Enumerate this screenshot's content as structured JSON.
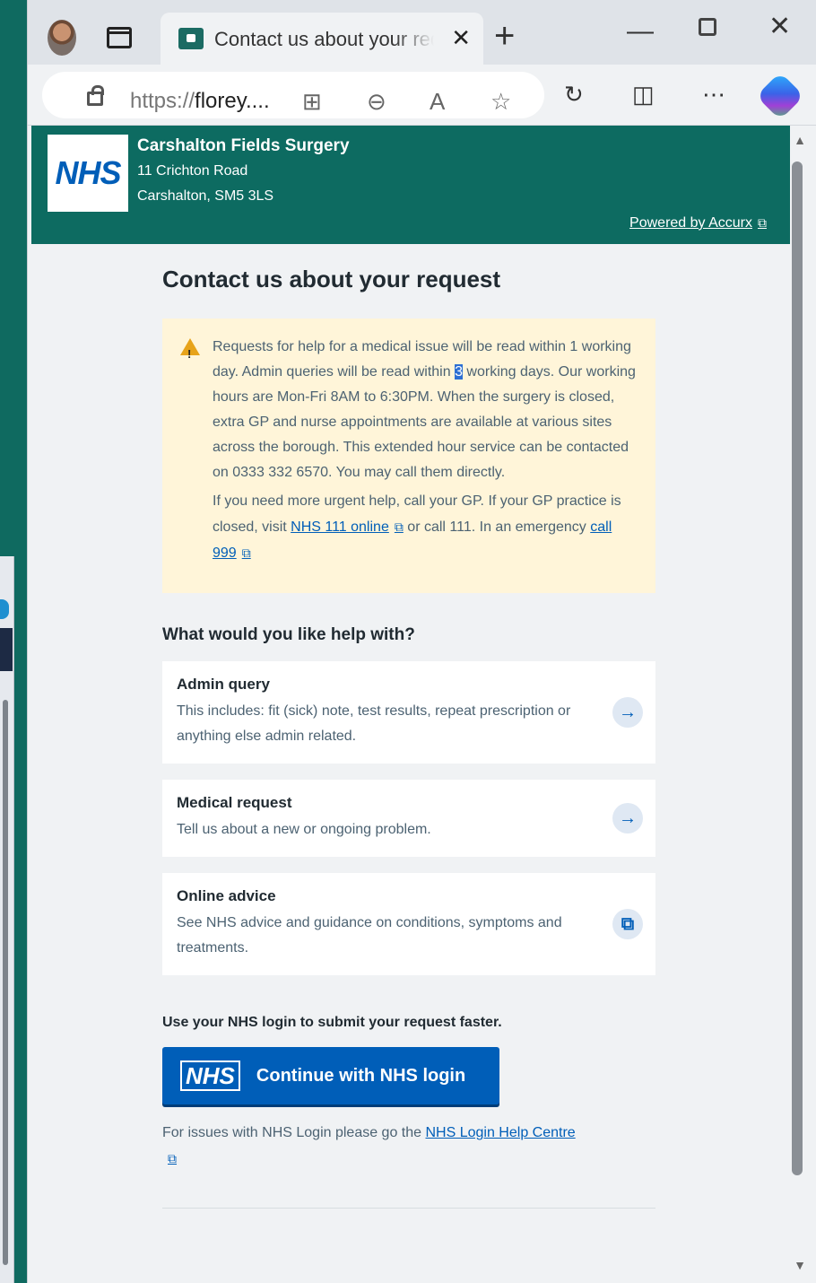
{
  "browser": {
    "tab_title": "Contact us about your request",
    "url_proto": "https://",
    "url_host": "florey....",
    "icons": [
      "profile-avatar",
      "tab-actions-icon",
      "close-icon",
      "plus-icon",
      "minimize-icon",
      "maximize-icon",
      "close-window-icon",
      "lock-icon",
      "app-available-icon",
      "zoom-icon",
      "read-aloud-icon",
      "favorite-icon",
      "extensions-icon",
      "split-screen-icon",
      "more-icon",
      "copilot-icon"
    ]
  },
  "header": {
    "logo": "NHS",
    "practice_name": "Carshalton Fields Surgery",
    "address_line1": "11 Crichton Road",
    "address_line2": "Carshalton, SM5 3LS",
    "powered_by": "Powered by Accurx"
  },
  "page": {
    "title": "Contact us about your request",
    "notice": {
      "p1_a": "Requests for help for a medical issue will be read within 1 working day. Admin queries will be read within ",
      "p1_sel": "3",
      "p1_b": " working days. Our working hours are Mon-Fri 8AM to 6:30PM. When the surgery is closed, extra GP and nurse appointments are available at various sites across the borough. This extended hour service can be contacted on 0333 332 6570. You may call them directly.",
      "p2_a": "If you need more urgent help, call your GP. If your GP practice is closed, visit ",
      "p2_link1": "NHS 111 online",
      "p2_b": " or call 111. In an emergency ",
      "p2_link2": "call 999"
    },
    "question": "What would you like help with?",
    "options": [
      {
        "title": "Admin query",
        "description": "This includes: fit (sick) note, test results, repeat prescription or anything else admin related.",
        "icon": "arrow-right-icon",
        "glyph": "→"
      },
      {
        "title": "Medical request",
        "description": "Tell us about a new or ongoing problem.",
        "icon": "arrow-right-icon",
        "glyph": "→"
      },
      {
        "title": "Online advice",
        "description": "See NHS advice and guidance on conditions, symptoms and treatments.",
        "icon": "external-link-icon",
        "glyph": "⧉"
      }
    ],
    "login_prompt": "Use your NHS login to submit your request faster.",
    "login_button_mark": "NHS",
    "login_button_label": "Continue with NHS login",
    "help_text": "For issues with NHS Login please go the ",
    "help_link": "NHS Login Help Centre"
  }
}
